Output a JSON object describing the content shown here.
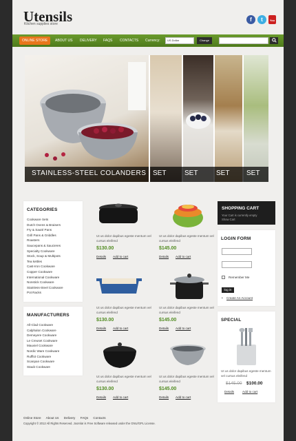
{
  "header": {
    "logo": "Utensils",
    "tagline": "Kitchen supplies store",
    "social": {
      "facebook": "f",
      "twitter": "t",
      "youtube": "You"
    }
  },
  "nav": {
    "items": [
      "Online Store",
      "About Us",
      "Delivery",
      "FAQs",
      "Contacts"
    ],
    "currency_label": "Currency:",
    "currency_value": "US Dollar",
    "change_label": "Change",
    "search_icon": "search-icon",
    "active_color": "#e8761c",
    "bar_color": "#5a8a23"
  },
  "hero": {
    "caption": "STAINLESS-STEEL COLANDERS",
    "sets": [
      "SET",
      "SET",
      "SET",
      "SET"
    ]
  },
  "categories": {
    "title": "CATEGORIES",
    "items": [
      "Cookware Sets",
      "Dutch Ovens & Braisers",
      "Fry & Sauté Pans",
      "Grill Pans & Griddles",
      "Roasters",
      "Saucepans & Saucieres",
      "Specialty Cookware",
      "Stock, Soup & Multipots",
      "Tea kettles",
      "Cast-Iron Cookware",
      "Copper Cookware",
      "International Cookware",
      "Nonstick Cookware",
      "Stainless-Steel Cookware",
      "Pot Racks"
    ]
  },
  "manufacturers": {
    "title": "MANUFACTURERS",
    "items": [
      "All-Clad Cookware",
      "Calphalon Cookware",
      "Demeyere Cookware",
      "Le Creuset Cookware",
      "Mauviel Cookware",
      "Nordic Ware Cookware",
      "Rufflot Cookware",
      "Scanpan Cookware",
      "Staub Cookware"
    ]
  },
  "products": [
    {
      "desc": "Ut us dolor dapibus egeste mentum vel cursus eleifend",
      "price": "$130.00",
      "details": "Details",
      "add": "Add to cart"
    },
    {
      "desc": "Ut us dolor dapibus egeste mentum vel cursus eleifend",
      "price": "$145.00",
      "details": "Details",
      "add": "Add to cart"
    },
    {
      "desc": "Ut us dolor dapibus egeste mentum vel cursus eleifend",
      "price": "$130.00",
      "details": "Details",
      "add": "Add to cart"
    },
    {
      "desc": "Ut us dolor dapibus egeste mentum vel cursus eleifend",
      "price": "$145.00",
      "details": "Details",
      "add": "Add to cart"
    },
    {
      "desc": "Ut us dolor dapibus egeste mentum vel cursus eleifend",
      "price": "$130.00",
      "details": "Details",
      "add": "Add to cart"
    },
    {
      "desc": "Ut us dolor dapibus egeste mentum vel cursus eleifend",
      "price": "$145.00",
      "details": "Details",
      "add": "Add to cart"
    }
  ],
  "cart": {
    "title": "SHOPPING CART",
    "text": "Your Cart is currently empty",
    "link": "Show Cart"
  },
  "login": {
    "title": "LOGIN FORM",
    "remember": "Remember Me",
    "button": "log in",
    "create": "Create An Account"
  },
  "special": {
    "title": "SPECIAL",
    "desc": "Ut us dolor dapibus egeste mentum vel cursus eleifend",
    "old_price": "$145.00",
    "new_price": "$100.00",
    "details": "Details",
    "add": "Add to cart"
  },
  "footer": {
    "links": [
      "Online Store",
      "About Us",
      "Delivery",
      "FAQs",
      "Contacts"
    ],
    "copyright": "Copyright © 2012 All Rights Reserved. Joomla! is Free Software released under the GNU/GPL License."
  }
}
